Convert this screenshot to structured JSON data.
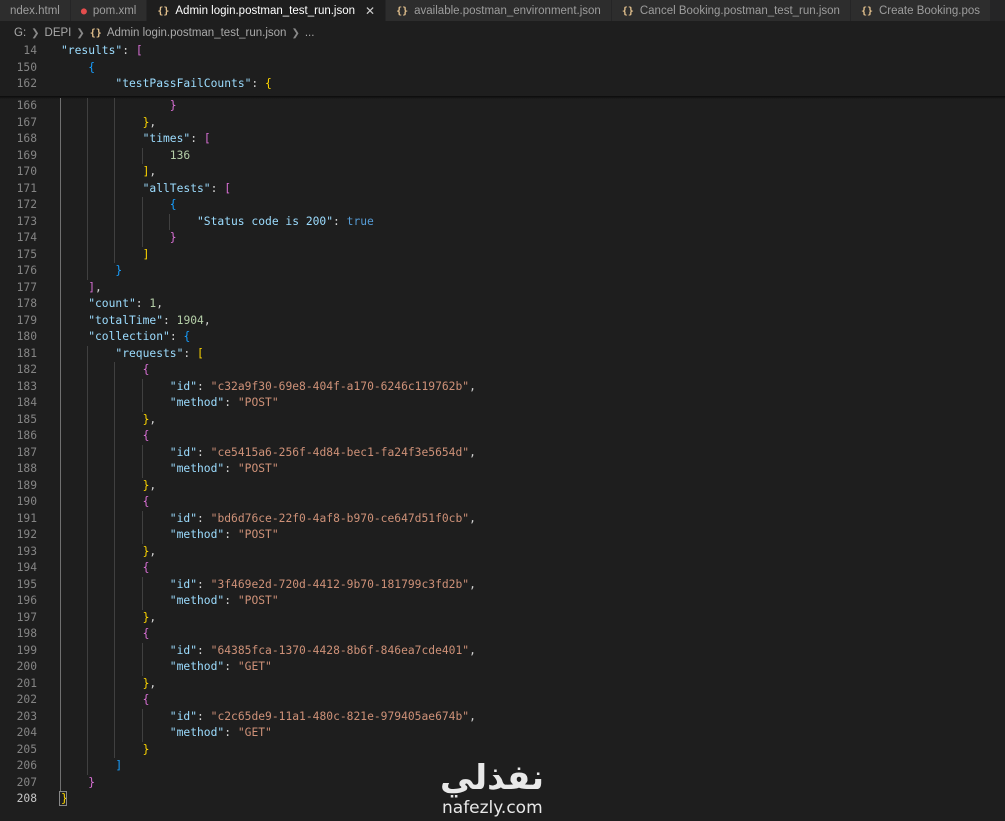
{
  "tabs": [
    {
      "label": "ndex.html",
      "icon": "html-file-icon",
      "active": false
    },
    {
      "label": "pom.xml",
      "icon": "xml-file-icon",
      "active": false
    },
    {
      "label": "Admin login.postman_test_run.json",
      "icon": "json-file-icon",
      "active": true
    },
    {
      "label": "available.postman_environment.json",
      "icon": "json-file-icon",
      "active": false
    },
    {
      "label": "Cancel Booking.postman_test_run.json",
      "icon": "json-file-icon",
      "active": false
    },
    {
      "label": "Create Booking.pos",
      "icon": "json-file-icon",
      "active": false
    }
  ],
  "breadcrumb": {
    "drive": "G:",
    "folder": "DEPI",
    "file": "Admin login.postman_test_run.json",
    "more": "..."
  },
  "sticky": [
    {
      "num": "14",
      "text": "\"results\": ["
    },
    {
      "num": "150",
      "text": "{"
    },
    {
      "num": "162",
      "text": "\"testPassFailCounts\": {"
    }
  ],
  "lines": [
    {
      "num": "166",
      "text": "}"
    },
    {
      "num": "167",
      "text": "},"
    },
    {
      "num": "168",
      "text": "\"times\": ["
    },
    {
      "num": "169",
      "text": "136"
    },
    {
      "num": "170",
      "text": "],"
    },
    {
      "num": "171",
      "text": "\"allTests\": ["
    },
    {
      "num": "172",
      "text": "{"
    },
    {
      "num": "173",
      "text": "\"Status code is 200\": true"
    },
    {
      "num": "174",
      "text": "}"
    },
    {
      "num": "175",
      "text": "]"
    },
    {
      "num": "176",
      "text": "}"
    },
    {
      "num": "177",
      "text": "],"
    },
    {
      "num": "178",
      "text": "\"count\": 1,"
    },
    {
      "num": "179",
      "text": "\"totalTime\": 1904,"
    },
    {
      "num": "180",
      "text": "\"collection\": {"
    },
    {
      "num": "181",
      "text": "\"requests\": ["
    },
    {
      "num": "182",
      "text": "{"
    },
    {
      "num": "183",
      "text": "\"id\": \"c32a9f30-69e8-404f-a170-6246c119762b\","
    },
    {
      "num": "184",
      "text": "\"method\": \"POST\""
    },
    {
      "num": "185",
      "text": "},"
    },
    {
      "num": "186",
      "text": "{"
    },
    {
      "num": "187",
      "text": "\"id\": \"ce5415a6-256f-4d84-bec1-fa24f3e5654d\","
    },
    {
      "num": "188",
      "text": "\"method\": \"POST\""
    },
    {
      "num": "189",
      "text": "},"
    },
    {
      "num": "190",
      "text": "{"
    },
    {
      "num": "191",
      "text": "\"id\": \"bd6d76ce-22f0-4af8-b970-ce647d51f0cb\","
    },
    {
      "num": "192",
      "text": "\"method\": \"POST\""
    },
    {
      "num": "193",
      "text": "},"
    },
    {
      "num": "194",
      "text": "{"
    },
    {
      "num": "195",
      "text": "\"id\": \"3f469e2d-720d-4412-9b70-181799c3fd2b\","
    },
    {
      "num": "196",
      "text": "\"method\": \"POST\""
    },
    {
      "num": "197",
      "text": "},"
    },
    {
      "num": "198",
      "text": "{"
    },
    {
      "num": "199",
      "text": "\"id\": \"64385fca-1370-4428-8b6f-846ea7cde401\","
    },
    {
      "num": "200",
      "text": "\"method\": \"GET\""
    },
    {
      "num": "201",
      "text": "},"
    },
    {
      "num": "202",
      "text": "{"
    },
    {
      "num": "203",
      "text": "\"id\": \"c2c65de9-11a1-480c-821e-979405ae674b\","
    },
    {
      "num": "204",
      "text": "\"method\": \"GET\""
    },
    {
      "num": "205",
      "text": "}"
    },
    {
      "num": "206",
      "text": "]"
    },
    {
      "num": "207",
      "text": "}"
    },
    {
      "num": "208",
      "text": "}"
    }
  ],
  "watermark": {
    "arabic": "نفذلي",
    "latin": "nafezly.com"
  },
  "colors": {
    "key": "#9cdcfe",
    "string": "#ce9178",
    "number": "#b5cea8",
    "boolean": "#569cd6",
    "bracket_gold": "#ffd700",
    "bracket_pink": "#da70d6",
    "bracket_blue": "#179fff"
  }
}
